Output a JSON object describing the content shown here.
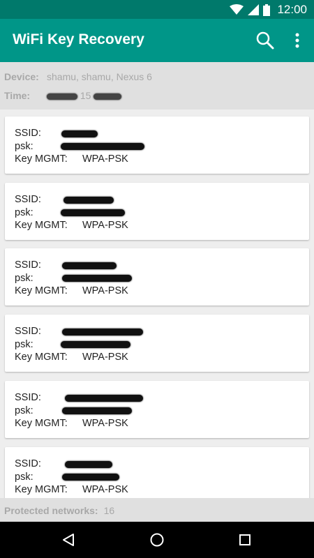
{
  "status_bar": {
    "time": "12:00"
  },
  "app_bar": {
    "title": "WiFi Key Recovery"
  },
  "info": {
    "device_label": "Device:",
    "device_value": "shamu, shamu, Nexus 6",
    "time_label": "Time:",
    "time_value_visible": "15"
  },
  "networks": [
    {
      "ssid_label": "SSID:",
      "psk_label": "psk:",
      "key_mgmt_label": "Key MGMT:",
      "key_mgmt": "WPA-PSK"
    },
    {
      "ssid_label": "SSID:",
      "psk_label": "psk:",
      "key_mgmt_label": "Key MGMT:",
      "key_mgmt": "WPA-PSK"
    },
    {
      "ssid_label": "SSID:",
      "psk_label": "psk:",
      "key_mgmt_label": "Key MGMT:",
      "key_mgmt": "WPA-PSK"
    },
    {
      "ssid_label": "SSID:",
      "psk_label": "psk:",
      "key_mgmt_label": "Key MGMT:",
      "key_mgmt": "WPA-PSK"
    },
    {
      "ssid_label": "SSID:",
      "psk_label": "psk:",
      "key_mgmt_label": "Key MGMT:",
      "key_mgmt": "WPA-PSK"
    },
    {
      "ssid_label": "SSID:",
      "psk_label": "psk:",
      "key_mgmt_label": "Key MGMT:",
      "key_mgmt": "WPA-PSK"
    }
  ],
  "footer": {
    "label": "Protected networks:",
    "count": "16"
  },
  "icons": {
    "search": "search-icon",
    "overflow": "more-vert-icon",
    "back": "back-icon",
    "home": "home-icon",
    "recents": "recents-icon"
  },
  "colors": {
    "primary": "#009688",
    "primary_dark": "#00796b"
  }
}
